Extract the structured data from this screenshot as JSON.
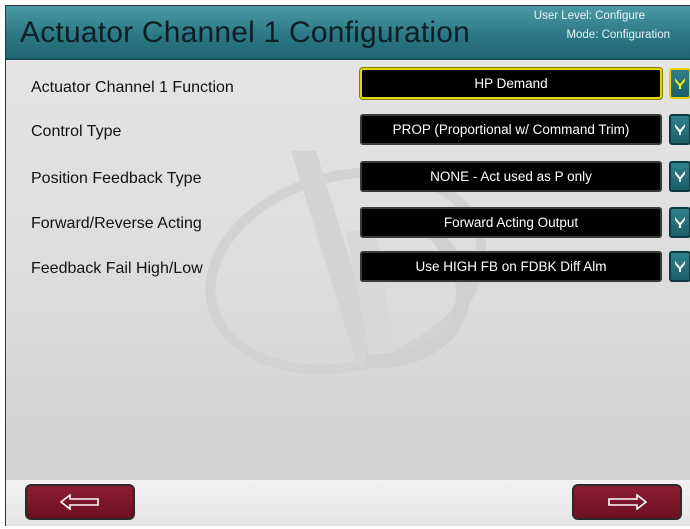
{
  "header": {
    "title": "Actuator Channel 1 Configuration",
    "user_level": "User Level: Configure",
    "mode": "Mode: Configuration",
    "background_color": "#2d7886"
  },
  "rows": [
    {
      "label": "Actuator Channel 1 Function",
      "value": "HP Demand",
      "selected": true
    },
    {
      "label": "Control Type",
      "value": "PROP (Proportional w/ Command Trim)",
      "selected": false
    },
    {
      "label": "Position Feedback Type",
      "value": "NONE - Act used as P only",
      "selected": false
    },
    {
      "label": "Forward/Reverse Acting",
      "value": "Forward Acting Output",
      "selected": false
    },
    {
      "label": "Feedback Fail High/Low",
      "value": "Use HIGH FB on FDBK Diff Alm",
      "selected": false
    }
  ],
  "icons": {
    "dropdown": "chevron-down-icon",
    "back": "arrow-left-icon",
    "next": "arrow-right-icon",
    "watermark": "woodward-logo"
  },
  "colors": {
    "field_background": "#000000",
    "selection_border": "#e8d400",
    "nav_button": "#8c1c31"
  }
}
